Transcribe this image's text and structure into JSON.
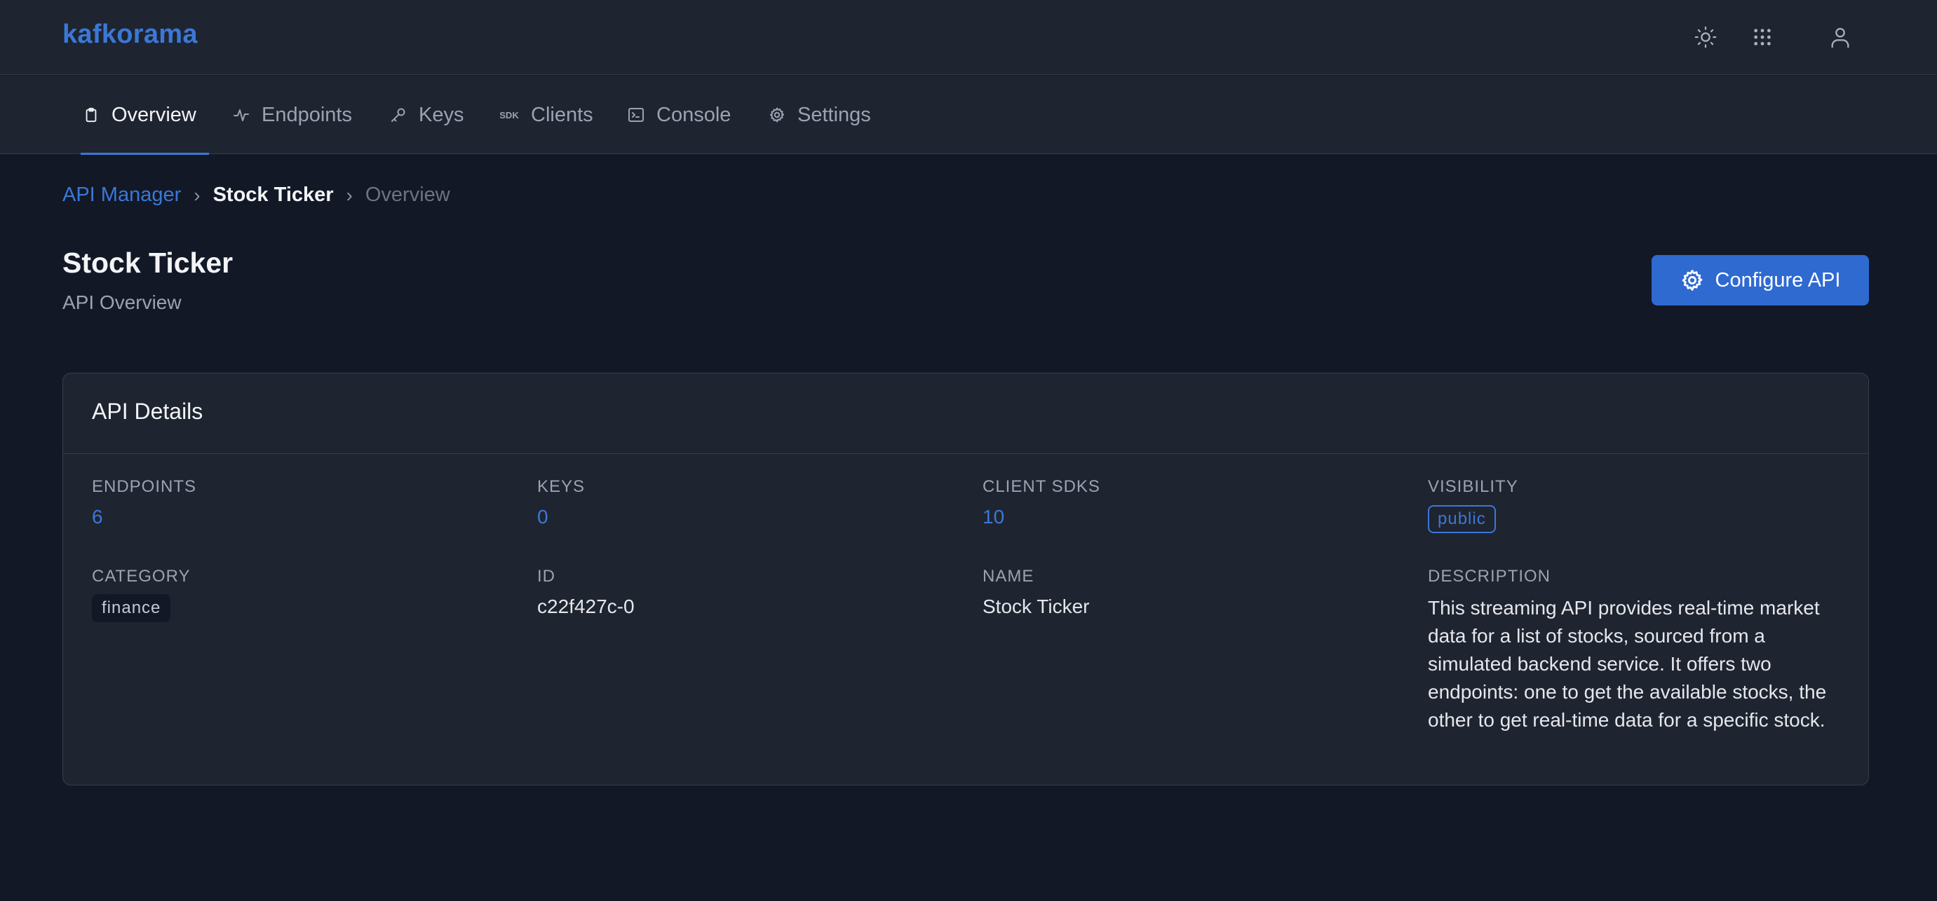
{
  "app": {
    "brand": "kafkorama"
  },
  "header_icons": [
    "sun-icon",
    "grid-icon",
    "user-icon"
  ],
  "tabs": [
    {
      "label": "Overview",
      "icon": "clipboard-icon",
      "active": true
    },
    {
      "label": "Endpoints",
      "icon": "activity-icon"
    },
    {
      "label": "Keys",
      "icon": "key-icon"
    },
    {
      "label": "Clients",
      "icon": "sdk-icon",
      "icon_text": "SDK"
    },
    {
      "label": "Console",
      "icon": "terminal-icon"
    },
    {
      "label": "Settings",
      "icon": "gear-icon"
    }
  ],
  "breadcrumb": {
    "root": "API Manager",
    "current": "Stock Ticker",
    "last": "Overview",
    "sep": "›"
  },
  "page": {
    "title": "Stock Ticker",
    "subtitle": "API Overview"
  },
  "actions": {
    "configure_label": "Configure API"
  },
  "card": {
    "title": "API Details",
    "fields": {
      "endpoints": {
        "label": "ENDPOINTS",
        "value": "6"
      },
      "keys": {
        "label": "KEYS",
        "value": "0"
      },
      "client_sdks": {
        "label": "CLIENT SDKS",
        "value": "10"
      },
      "visibility": {
        "label": "VISIBILITY",
        "value": "public"
      },
      "category": {
        "label": "CATEGORY",
        "value": "finance"
      },
      "id": {
        "label": "ID",
        "value": "c22f427c-0"
      },
      "name": {
        "label": "NAME",
        "value": "Stock Ticker"
      },
      "description": {
        "label": "DESCRIPTION",
        "value": "This streaming API provides real-time market data for a list of stocks, sourced from a simulated backend service. It offers two endpoints: one to get the available stocks, the other to get real-time data for a specific stock."
      }
    }
  },
  "colors": {
    "accent": "#3b78d6",
    "background": "#121826",
    "surface": "#1f2431",
    "button": "#2f6ad1"
  }
}
